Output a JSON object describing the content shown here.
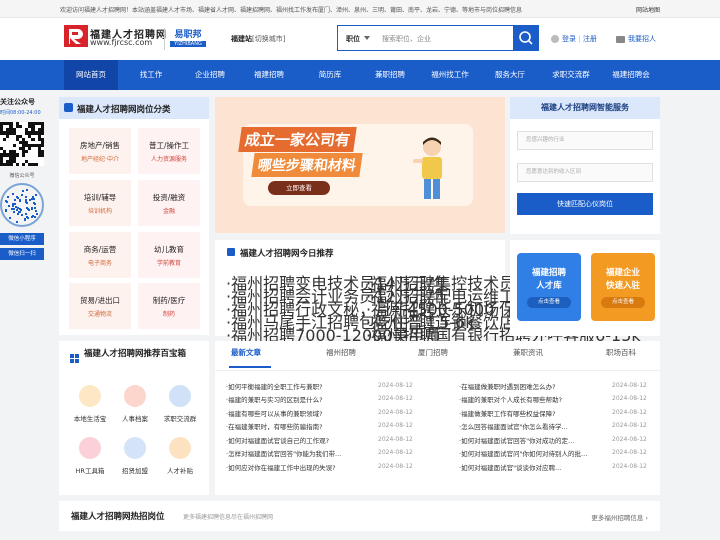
{
  "topbar": {
    "welcome": "欢迎访问福建人才招聘网！本站涵盖福建人才市场、福建省人才网、福建招聘网、福州找工作发布厦门、漳州、泉州、三明、莆田、南平、龙岩、宁德、等地市与岗位招聘信息",
    "sitemap": "网站地图"
  },
  "header": {
    "logo_title": "福建人才招聘网",
    "logo_url": "www.fjrcsc.com",
    "partner_logo": "易职邦",
    "partner_sub": "YIZHIBANG",
    "site_label": "福建站",
    "site_switch": "[切换城市]",
    "search_category": "职位",
    "search_placeholder": "搜索职位、企业",
    "login": "登录",
    "divider": "|",
    "register": "注册",
    "recruit": "我要招人"
  },
  "nav": [
    "网站首页",
    "找工作",
    "企业招聘",
    "福建招聘",
    "简历库",
    "兼职招聘",
    "福州找工作",
    "服务大厅",
    "求职交流群",
    "福建招聘会"
  ],
  "qr_column": {
    "heading": "关注公众号",
    "hours": "时间08:00-24:00",
    "label1": "微信公众号",
    "label2": "微信小程序",
    "button": "微信扫一扫"
  },
  "categories": {
    "title": "福建人才招聘网岗位分类",
    "items": [
      {
        "name": "房地产/销售",
        "sub": "地产经纪·中介"
      },
      {
        "name": "普工/操作工",
        "sub": "人力资源服务"
      },
      {
        "name": "培训/辅导",
        "sub": "培训机构"
      },
      {
        "name": "投资/融资",
        "sub": "金融"
      },
      {
        "name": "商务/运营",
        "sub": "电子商务"
      },
      {
        "name": "幼儿教育",
        "sub": "学前教育"
      },
      {
        "name": "贸易/进出口",
        "sub": "交通物流"
      },
      {
        "name": "制药/医疗",
        "sub": "制药"
      }
    ]
  },
  "banner": {
    "line1": "成立一家公司有",
    "line2": "哪些步骤和材料",
    "button": "立即查看"
  },
  "recommend": {
    "title": "福建人才招聘网今日推荐",
    "left": [
      "·福州招聘变电技术员14万元/年",
      "·福州招聘会计业务员12万元/年",
      "·福州招聘行政文秘，月薪4500-5000",
      "·福州马尾手江招聘包吃住普工5-6k",
      "·福州招聘7000-12000美甲师"
    ],
    "right": [
      "·福州招聘集控技术员兼安全员16万...",
      "·福州招聘配电运维工9000元/月",
      "·福州招聘长乐机场保洁4k+",
      "·福州招聘连锁餐饮店店长1-1.3W",
      "·福州招聘国有银行招聘外呼客服6-15k"
    ]
  },
  "smart": {
    "title": "福建人才招聘网智能服务",
    "field1": "您感兴趣的行业",
    "field2": "您愿意达到的收入区间",
    "button": "快速匹配心仪岗位"
  },
  "tiles": [
    {
      "line1": "福建招聘",
      "line2": "人才库",
      "button": "点击查看",
      "color": "#2f7fe6"
    },
    {
      "line1": "福建企业",
      "line2": "快速入驻",
      "button": "点击查看",
      "color": "#f39a23"
    }
  ],
  "toolbox": {
    "title": "福建人才招聘网推荐百宝箱",
    "items": [
      {
        "label": "本地生活宝",
        "color": "#e8b03a"
      },
      {
        "label": "人事档案",
        "color": "#e06a4a"
      },
      {
        "label": "求职交流群",
        "color": "#3a82e0"
      },
      {
        "label": "HR工具箱",
        "color": "#e04a5a"
      },
      {
        "label": "招贤加盟",
        "color": "#4a8ae0"
      },
      {
        "label": "人才补贴",
        "color": "#e09a3a"
      }
    ]
  },
  "news": {
    "tabs": [
      "最新文章",
      "福州招聘",
      "厦门招聘",
      "兼职资讯",
      "职场百科"
    ],
    "left": [
      {
        "t": "·如何平衡福建的全职工作与兼职?",
        "d": "2024-08-12"
      },
      {
        "t": "·福建的兼职与实习的区别是什么?",
        "d": "2024-08-12"
      },
      {
        "t": "·福建有哪些可以从事的兼职领域?",
        "d": "2024-08-12"
      },
      {
        "t": "·在福建兼职时，有哪些防骗指南?",
        "d": "2024-08-12"
      },
      {
        "t": "·如何对福建面试官谈自己的工作观?",
        "d": "2024-08-12"
      },
      {
        "t": "·怎样对福建面试官回答\"你能为我们带...",
        "d": "2024-08-12"
      },
      {
        "t": "·如何应对你在福建工作中出现的失误?",
        "d": "2024-08-12"
      }
    ],
    "right": [
      {
        "t": "·在福建做兼职时遇到困难怎么办?",
        "d": "2024-08-12"
      },
      {
        "t": "·福建的兼职对个人成长有哪些帮助?",
        "d": "2024-08-12"
      },
      {
        "t": "·福建做兼职工作有哪些权益保障?",
        "d": "2024-08-12"
      },
      {
        "t": "·怎么回答福建面试官\"你怎么看待学...",
        "d": "2024-08-12"
      },
      {
        "t": "·如何对福建面试官回答\"你对成功的定...",
        "d": "2024-08-12"
      },
      {
        "t": "·如何对福建面试官问\"你如何对待别人的批...",
        "d": "2024-08-12"
      },
      {
        "t": "·如何对福建面试官\"谈谈你对应聘...",
        "d": "2024-08-12"
      }
    ]
  },
  "hot": {
    "title": "福建人才招聘网热招岗位",
    "sub": "更多福建招聘信息尽在福州招聘网",
    "more": "更多福州招聘信息"
  }
}
